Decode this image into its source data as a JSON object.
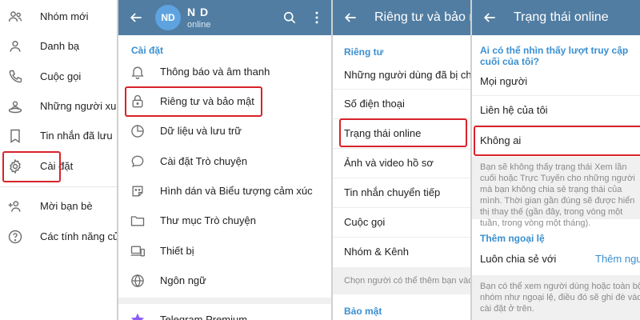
{
  "menu": {
    "items": [
      {
        "label": "Nhóm mới",
        "icon": "group-icon"
      },
      {
        "label": "Danh bạ",
        "icon": "contacts-icon"
      },
      {
        "label": "Cuộc gọi",
        "icon": "phone-icon"
      },
      {
        "label": "Những người xung",
        "icon": "people-nearby-icon"
      },
      {
        "label": "Tin nhắn đã lưu",
        "icon": "bookmark-icon"
      },
      {
        "label": "Cài đặt",
        "icon": "gear-icon"
      },
      {
        "label": "Mời bạn bè",
        "icon": "add-user-icon"
      },
      {
        "label": "Các tính năng của",
        "icon": "question-icon"
      }
    ]
  },
  "settings": {
    "avatar": "ND",
    "name": "N D",
    "status": "online",
    "section": "Cài đặt",
    "items": [
      {
        "label": "Thông báo và âm thanh",
        "icon": "bell-icon"
      },
      {
        "label": "Riêng tư và bảo mật",
        "icon": "lock-icon"
      },
      {
        "label": "Dữ liệu và lưu trữ",
        "icon": "pie-chart-icon"
      },
      {
        "label": "Cài đặt Trò chuyện",
        "icon": "chat-bubble-icon"
      },
      {
        "label": "Hình dán và Biểu tượng cảm xúc",
        "icon": "sticker-icon"
      },
      {
        "label": "Thư mục Trò chuyện",
        "icon": "folder-icon"
      },
      {
        "label": "Thiết bị",
        "icon": "devices-icon"
      },
      {
        "label": "Ngôn ngữ",
        "icon": "globe-icon"
      }
    ],
    "premium": "Telegram Premium"
  },
  "privacy": {
    "title": "Riêng tư và bảo mật",
    "section": "Riêng tư",
    "items": [
      {
        "label": "Những người dùng đã bị chặn"
      },
      {
        "label": "Số điện thoại"
      },
      {
        "label": "Trạng thái online"
      },
      {
        "label": "Ảnh và video hồ sơ"
      },
      {
        "label": "Tin nhắn chuyển tiếp"
      },
      {
        "label": "Cuộc gọi"
      },
      {
        "label": "Nhóm & Kênh"
      }
    ],
    "footnote": "Chọn người có thể thêm bạn vào nhóm",
    "security_section": "Bảo mật"
  },
  "online_status": {
    "title": "Trạng thái online",
    "question": "Ai có thể nhìn thấy lượt truy cập cuối của tôi?",
    "options": [
      {
        "label": "Mọi người"
      },
      {
        "label": "Liên hệ của tôi"
      },
      {
        "label": "Không ai"
      }
    ],
    "description": "Bạn sẽ không thấy trạng thái Xem lần cuối hoặc Trực Tuyến cho những người mà bạn không chia sẻ trạng thái của mình. Thời gian gần đúng sẽ được hiển thị thay thế (gần đây, trong vòng một tuần, trong vòng một tháng).",
    "exceptions_section": "Thêm ngoại lệ",
    "always_share": "Luôn chia sẻ với",
    "add_users": "Thêm người dùng",
    "bottom_note": "Bạn có thể xem người dùng hoặc toàn bộ nhóm như ngoại lệ, điều đó sẽ ghi đè vào cài đặt ở trên."
  },
  "colors": {
    "header": "#517da2",
    "accent": "#3a8fd0",
    "highlight": "#d8232a"
  }
}
